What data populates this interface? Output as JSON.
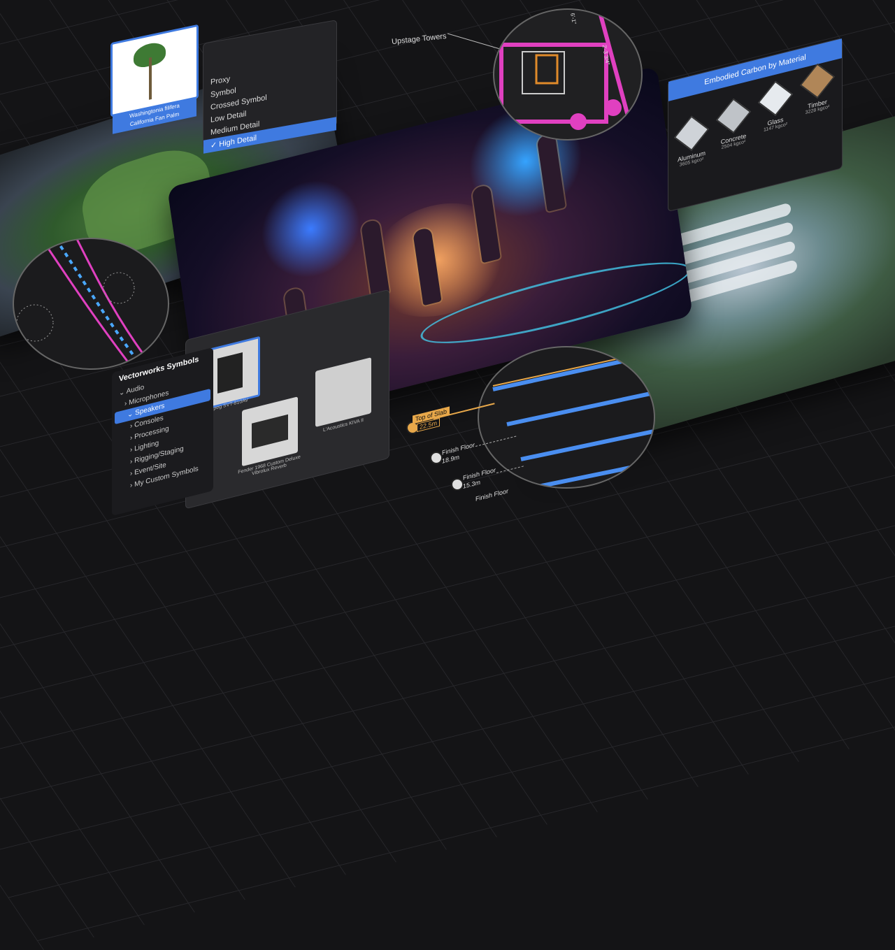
{
  "palm_card": {
    "caption_line1": "Washingtonia filifera",
    "caption_line2": "California Fan Palm"
  },
  "detail_menu": {
    "items": [
      "Proxy",
      "Symbol",
      "Crossed Symbol",
      "Low Detail",
      "Medium Detail",
      "✓ High Detail"
    ],
    "selected_index": 5
  },
  "callouts": {
    "upstage_towers": "Upstage Towers",
    "dim_label": "6'-1\"",
    "dim_label_2": "2'-3 3/4\""
  },
  "embodied_carbon": {
    "title": "Embodied Carbon by Material",
    "materials": [
      {
        "name": "Aluminum",
        "value": "3605 kgco²"
      },
      {
        "name": "Concrete",
        "value": "2504 kgco²"
      },
      {
        "name": "Glass",
        "value": "1147 kgco²"
      },
      {
        "name": "Timber",
        "value": "3228 kgco²"
      }
    ]
  },
  "symbols_panel": {
    "title": "Vectorworks Symbols",
    "items": [
      "Audio",
      "Microphones",
      "Speakers",
      "Consoles",
      "Processing",
      "Lighting",
      "Rigging/Staging",
      "Event/Site",
      "My Custom Symbols"
    ],
    "selected_index": 2
  },
  "thumbnails": {
    "items": [
      {
        "caption": "Ampeg SVT-810AV"
      },
      {
        "caption": "Fender 1968 Custom Deluxe Vibrolux Reverb"
      },
      {
        "caption": "L'Acoustics KIVA II"
      }
    ]
  },
  "levels": {
    "top_of_slab_label": "Top of Slab",
    "top_of_slab_value": "22.5m",
    "finish_floor_1_label": "Finish Floor",
    "finish_floor_1_value": "18.9m",
    "finish_floor_2_label": "Finish Floor",
    "finish_floor_2_value": "15.3m",
    "finish_floor_3_label": "Finish Floor"
  },
  "colors": {
    "accent": "#3f7ae0",
    "slab": "#e8a84a",
    "magenta": "#e040c0"
  }
}
